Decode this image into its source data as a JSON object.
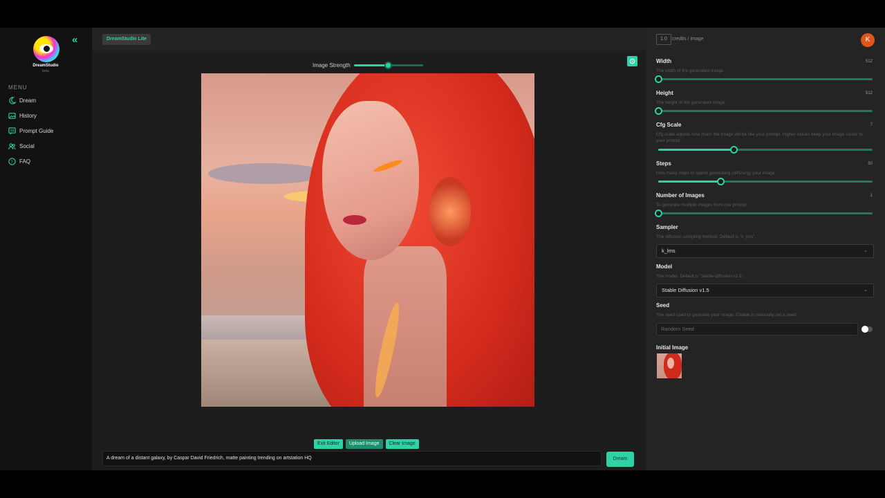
{
  "sidebar": {
    "brand": "DreamStudio",
    "beta": "beta",
    "menu_label": "MENU",
    "items": [
      {
        "label": "Dream",
        "icon": "dream-icon"
      },
      {
        "label": "History",
        "icon": "history-icon"
      },
      {
        "label": "Prompt Guide",
        "icon": "prompt-guide-icon"
      },
      {
        "label": "Social",
        "icon": "social-icon"
      },
      {
        "label": "FAQ",
        "icon": "faq-icon"
      }
    ]
  },
  "topbar": {
    "badge": "DreamStudio Lite"
  },
  "canvas": {
    "strength_label": "Image Strength",
    "strength_value": 0.5,
    "buttons": {
      "exit_editor": "Exit Editor",
      "upload_image": "Upload Image",
      "clear_image": "Clear Image"
    },
    "prompt": "A dream of a distant galaxy, by Caspar David Friedrich, matte painting trending on artstation HQ",
    "dream_button": "Dream"
  },
  "panel": {
    "credits_value": "1.0",
    "credits_label": "credits / image",
    "avatar_initial": "K",
    "width": {
      "title": "Width",
      "value": "512",
      "desc": "The width of the generated image.",
      "fraction": 0.0
    },
    "height": {
      "title": "Height",
      "value": "512",
      "desc": "The height of the generated image.",
      "fraction": 0.0
    },
    "cfg": {
      "title": "Cfg Scale",
      "value": "7",
      "desc": "Cfg scale adjusts how much the image will be like your prompt. Higher values keep your image closer to your prompt.",
      "fraction": 0.35
    },
    "steps": {
      "title": "Steps",
      "value": "50",
      "desc": "How many steps to spend generating (diffusing) your image.",
      "fraction": 0.29
    },
    "num_images": {
      "title": "Number of Images",
      "value": "1",
      "desc": "To generate multiple images from one prompt.",
      "fraction": 0.0
    },
    "sampler": {
      "title": "Sampler",
      "desc": "The diffusion sampling method. Default is \"k_lms\".",
      "value": "k_lms"
    },
    "model": {
      "title": "Model",
      "desc": "The model. Default is \"stable-diffusion-v1.5\".",
      "value": "Stable Diffusion v1.5"
    },
    "seed": {
      "title": "Seed",
      "desc": "The seed used to generate your image. Enable to manually set a seed.",
      "placeholder": "Random Seed"
    },
    "initial_image": {
      "title": "Initial Image"
    }
  },
  "colors": {
    "accent": "#2ed3a5",
    "avatar": "#e0551c"
  }
}
